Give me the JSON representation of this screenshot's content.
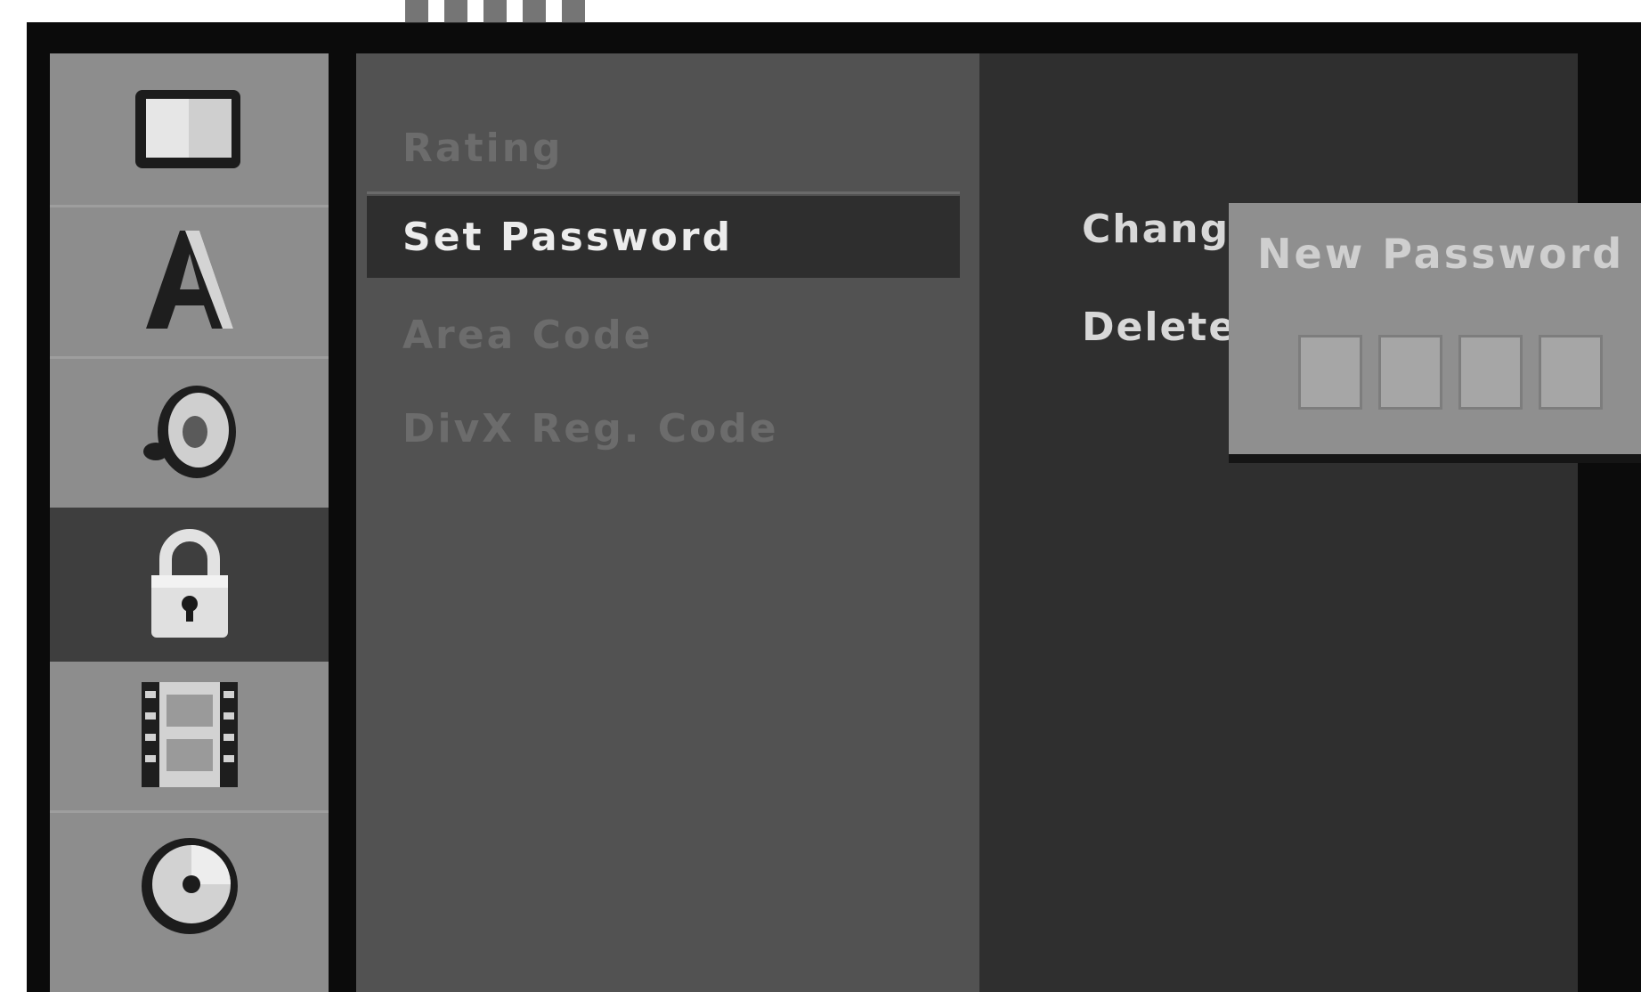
{
  "menu": {
    "items": [
      {
        "label": "Rating",
        "selected": false
      },
      {
        "label": "Set Password",
        "selected": true
      },
      {
        "label": "Area Code",
        "selected": false
      },
      {
        "label": "DivX Reg. Code",
        "selected": false
      }
    ]
  },
  "sidebar": {
    "categories": [
      {
        "icon": "tv-screen-icon",
        "selected": false
      },
      {
        "icon": "language-a-icon",
        "selected": false
      },
      {
        "icon": "speaker-icon",
        "selected": false
      },
      {
        "icon": "lock-icon",
        "selected": true
      },
      {
        "icon": "film-strip-icon",
        "selected": false
      },
      {
        "icon": "disc-icon",
        "selected": false
      }
    ]
  },
  "options": {
    "change_label": "Change",
    "delete_label": "Delete"
  },
  "popup": {
    "title": "New Password",
    "digit_count": 4,
    "digits": [
      "",
      "",
      "",
      ""
    ]
  },
  "colors": {
    "selected_bg": "#2e2e2e",
    "sidebar_bg": "#8d8d8d",
    "menu_bg": "#525252",
    "options_bg": "#2f2f2f"
  }
}
